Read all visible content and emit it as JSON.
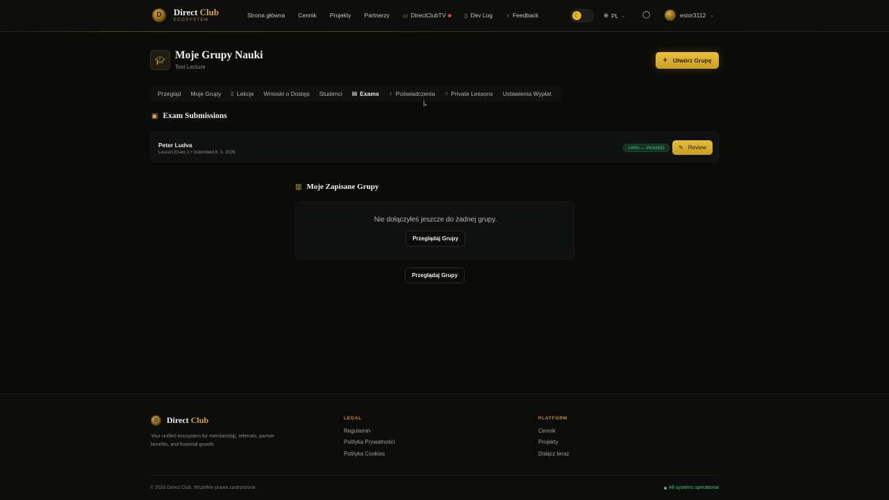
{
  "header": {
    "brand": {
      "name": "Direct",
      "name_accent": "Club",
      "subtitle": "ECOSYSTEM"
    },
    "nav": [
      {
        "label": "Strona główna",
        "icon": ""
      },
      {
        "label": "Cennik",
        "icon": ""
      },
      {
        "label": "Projekty",
        "icon": ""
      },
      {
        "label": "Partnerzy",
        "icon": ""
      },
      {
        "label": "DirectClubTV",
        "icon": "tv-icon",
        "live": true
      },
      {
        "label": "Dev Log",
        "icon": "book-icon"
      },
      {
        "label": "Feedback",
        "icon": "lightbulb-icon"
      }
    ],
    "theme_toggle": {
      "state": "dark"
    },
    "language": "PL",
    "user": {
      "name": "estor3112"
    }
  },
  "page": {
    "title": "Moje Grupy Nauki",
    "subtitle": "Test Lecture",
    "create_button": "Utwórz Grupę"
  },
  "tabs": [
    {
      "label": "Przegląd",
      "icon": "",
      "active": false
    },
    {
      "label": "Moje Grupy",
      "icon": "",
      "active": false
    },
    {
      "label": "Lekcje",
      "icon": "book-icon",
      "active": false
    },
    {
      "label": "Wnioski o Dostęp",
      "icon": "",
      "active": false
    },
    {
      "label": "Studenci",
      "icon": "",
      "active": false
    },
    {
      "label": "Exams",
      "icon": "clipboard-icon",
      "active": true
    },
    {
      "label": "Poświadczenia",
      "icon": "award-icon",
      "active": false
    },
    {
      "label": "Private Lessons",
      "icon": "chat-icon",
      "active": false
    },
    {
      "label": "Ustawienia Wypłat",
      "icon": "",
      "active": false
    }
  ],
  "exams": {
    "title": "Exam Submissions",
    "items": [
      {
        "student": "Peter Ludva",
        "meta": "Lesson Exam 1 • Submitted 8. 3. 2026",
        "status": "100% — PASSED",
        "action": "Review"
      }
    ]
  },
  "saved": {
    "title": "Moje Zapisane Grupy",
    "empty_message": "Nie dołączyłeś jeszcze do żadnej grupy.",
    "browse_button": "Przeglądaj Grupy",
    "browse_button_bottom": "Przeglądaj Grupy"
  },
  "footer": {
    "brand": {
      "name": "Direct",
      "name_accent": "Club"
    },
    "description": "Your unified ecosystem for membership, referrals, partner benefits, and financial growth.",
    "legal": {
      "heading": "LEGAL",
      "links": [
        "Regulamin",
        "Polityka Prywatności",
        "Polityka Cookies"
      ]
    },
    "platform": {
      "heading": "PLATFORM",
      "links": [
        "Cennik",
        "Projekty",
        "Dołącz teraz"
      ]
    },
    "copyright": "© 2026 Direct Club. Wszelkie prawa zastrzeżone.",
    "status": "All systems operational"
  },
  "colors": {
    "background": "#0b0b0a",
    "accent_gold": "#e0b038",
    "success_green": "#3fd586",
    "live_red": "#e03a3a"
  }
}
